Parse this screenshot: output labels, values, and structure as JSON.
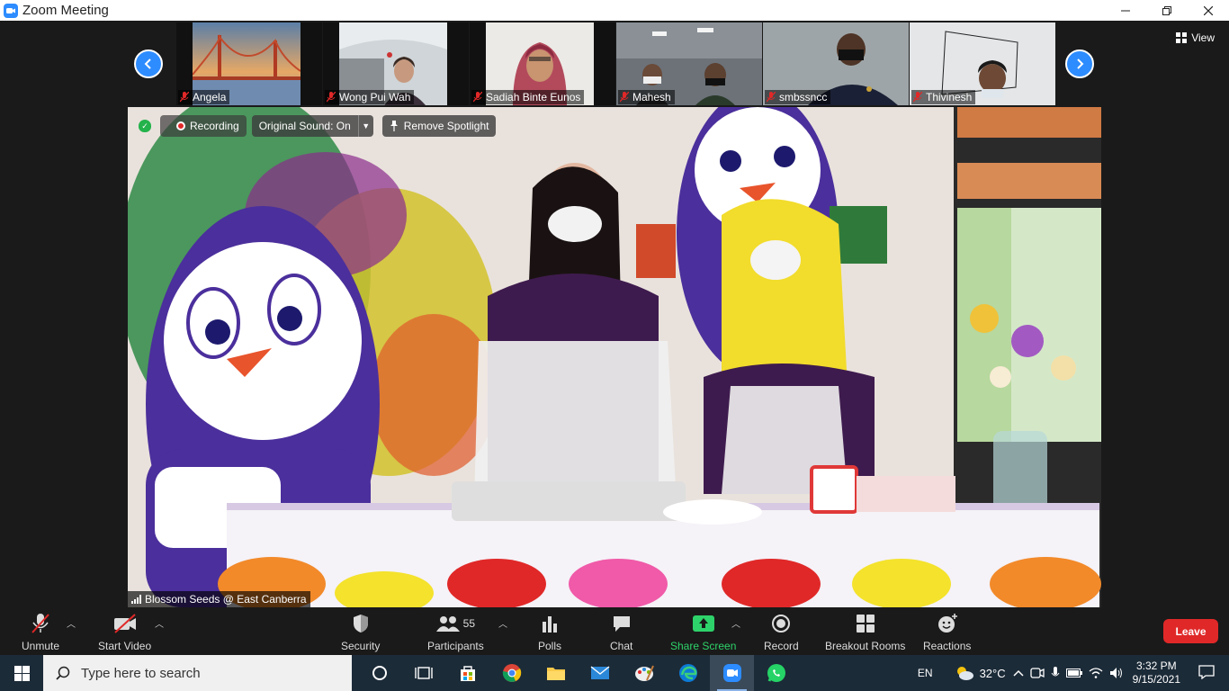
{
  "window": {
    "title": "Zoom Meeting",
    "minimize_icon": "minimize-icon",
    "restore_icon": "restore-icon",
    "close_icon": "close-icon"
  },
  "gallery_strip": {
    "participants": [
      {
        "name": "Angela",
        "muted": true
      },
      {
        "name": "Wong Pui Wah",
        "muted": true
      },
      {
        "name": "Sadiah Binte Eunos",
        "muted": true
      },
      {
        "name": "Mahesh",
        "muted": true
      },
      {
        "name": "smbssncc",
        "muted": true
      },
      {
        "name": "Thivinesh",
        "muted": true
      }
    ],
    "view_label": "View"
  },
  "main_video": {
    "recording_label": "Recording",
    "original_sound_label": "Original Sound: On",
    "remove_spotlight_label": "Remove Spotlight",
    "speaker_name": "Blossom Seeds @ East Canberra"
  },
  "controls": {
    "unmute": "Unmute",
    "start_video": "Start Video",
    "security": "Security",
    "participants": "Participants",
    "participants_count": "55",
    "polls": "Polls",
    "chat": "Chat",
    "share_screen": "Share Screen",
    "record": "Record",
    "breakout_rooms": "Breakout Rooms",
    "reactions": "Reactions",
    "leave": "Leave"
  },
  "taskbar": {
    "search_placeholder": "Type here to search",
    "language": "EN",
    "temperature": "32°C",
    "time": "3:32 PM",
    "date": "9/15/2021"
  },
  "colors": {
    "zoom_blue": "#2d8cff",
    "leave_red": "#e02828",
    "share_green": "#2ed26a",
    "taskbar_bg": "#1c2b38"
  }
}
